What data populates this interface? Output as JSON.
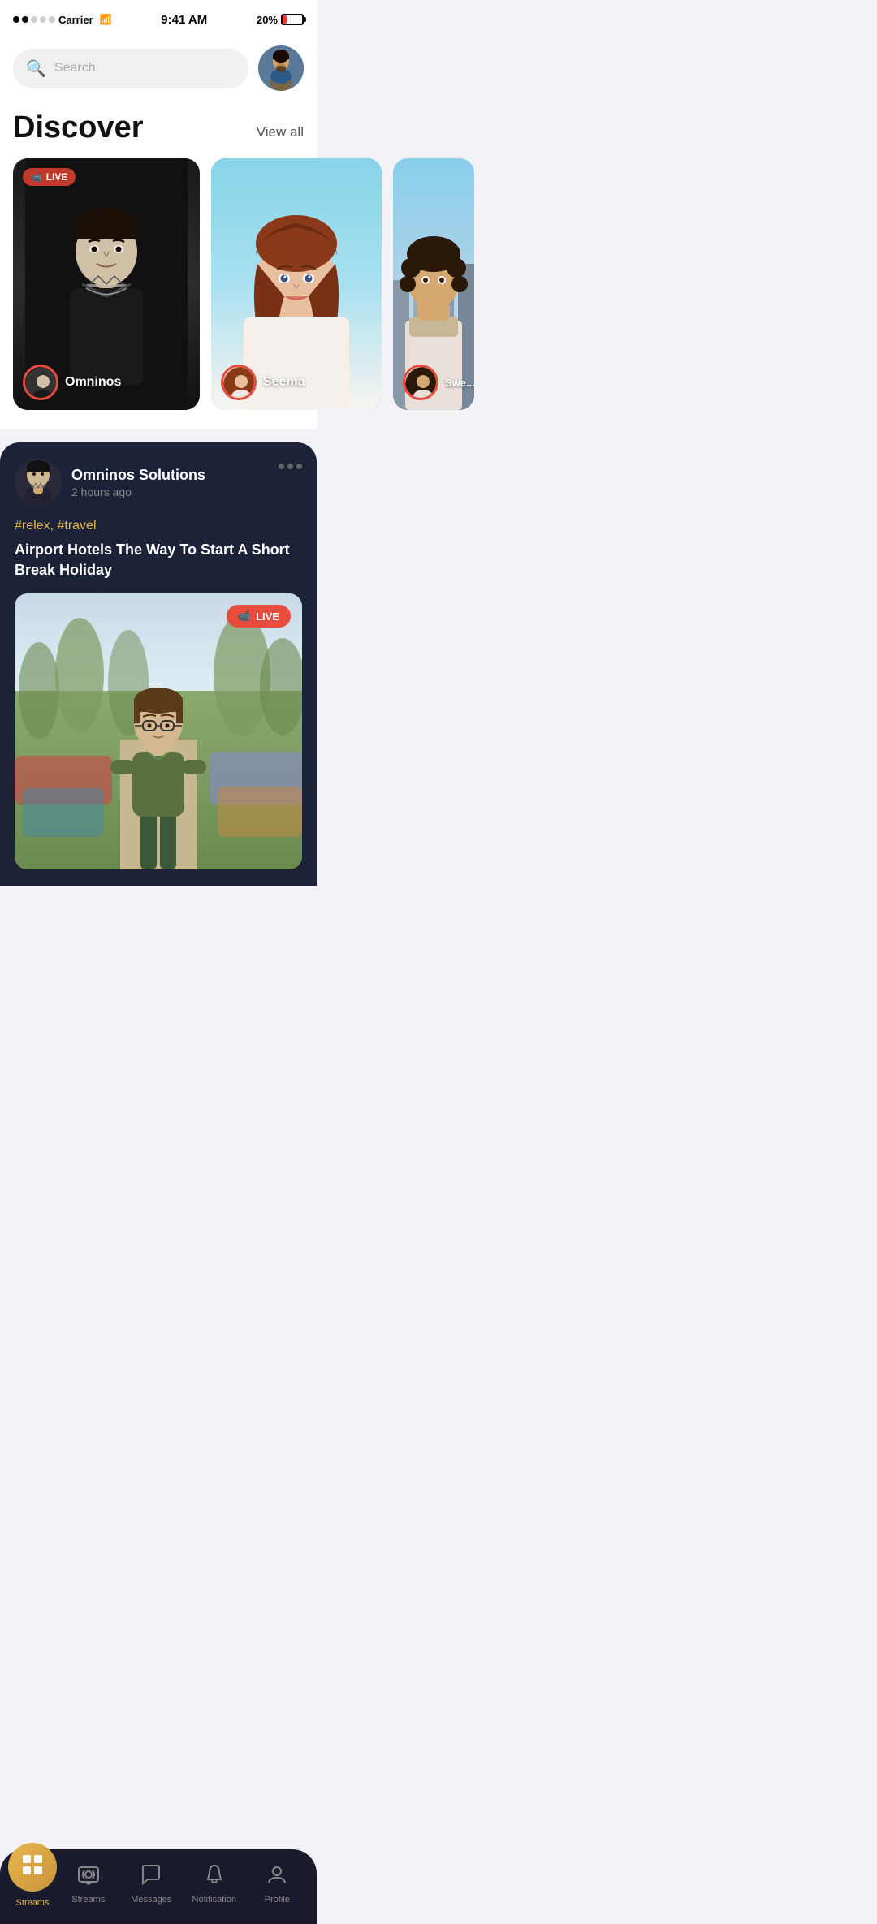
{
  "statusBar": {
    "carrier": "Carrier",
    "time": "9:41 AM",
    "battery": "20%",
    "signal": [
      true,
      true,
      false,
      false,
      false
    ]
  },
  "header": {
    "searchPlaceholder": "Search",
    "avatarAlt": "User avatar"
  },
  "discover": {
    "title": "Discover",
    "viewAll": "View all",
    "cards": [
      {
        "id": "card-1",
        "isLive": true,
        "username": "Omninos",
        "bgType": "bw-male"
      },
      {
        "id": "card-2",
        "isLive": false,
        "username": "Seema",
        "bgType": "colorful-female"
      },
      {
        "id": "card-3",
        "isLive": false,
        "username": "Swe...",
        "bgType": "outdoor-female"
      }
    ],
    "liveBadge": "LIVE"
  },
  "feed": {
    "post": {
      "username": "Omninos Solutions",
      "timeAgo": "2 hours ago",
      "tags": "#relex, #travel",
      "title": "Airport Hotels The Way To Start A Short Break Holiday",
      "isLive": true,
      "liveBadge": "LIVE"
    }
  },
  "bottomNav": {
    "items": [
      {
        "id": "home",
        "label": "Streams",
        "icon": "home",
        "active": true
      },
      {
        "id": "streams",
        "label": "Streams",
        "icon": "tv",
        "active": false
      },
      {
        "id": "messages",
        "label": "Messages",
        "icon": "chat",
        "active": false
      },
      {
        "id": "notification",
        "label": "Notification",
        "icon": "bell",
        "active": false
      },
      {
        "id": "profile",
        "label": "Profile",
        "icon": "person",
        "active": false
      }
    ]
  }
}
